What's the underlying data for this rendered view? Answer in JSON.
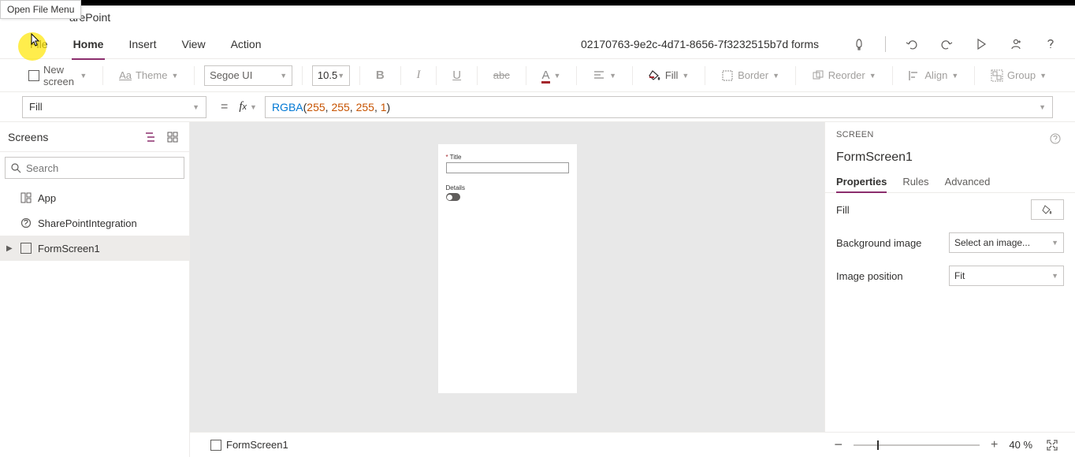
{
  "tooltip": "Open File Menu",
  "app_name": "arePoint",
  "tabs": {
    "file": "File",
    "home": "Home",
    "insert": "Insert",
    "view": "View",
    "action": "Action"
  },
  "doc_name": "02170763-9e2c-4d71-8656-7f3232515b7d forms",
  "toolbar": {
    "new_screen": "New screen",
    "theme": "Theme",
    "font": "Segoe UI",
    "font_size": "10.5",
    "fill": "Fill",
    "border": "Border",
    "reorder": "Reorder",
    "align": "Align",
    "group": "Group"
  },
  "formula": {
    "property": "Fill",
    "fn": "RGBA",
    "args": [
      "255",
      "255",
      "255",
      "1"
    ]
  },
  "screens": {
    "title": "Screens",
    "search_placeholder": "Search",
    "items": {
      "app": "App",
      "sp_integration": "SharePointIntegration",
      "form_screen": "FormScreen1"
    }
  },
  "preview": {
    "title": "Title",
    "details": "Details"
  },
  "props_panel": {
    "header_label": "SCREEN",
    "screen_name": "FormScreen1",
    "tabs": {
      "properties": "Properties",
      "rules": "Rules",
      "advanced": "Advanced"
    },
    "fill_label": "Fill",
    "bg_image_label": "Background image",
    "bg_image_value": "Select an image...",
    "img_pos_label": "Image position",
    "img_pos_value": "Fit"
  },
  "statusbar": {
    "screen": "FormScreen1",
    "zoom_pct": "40",
    "pct_symbol": "%"
  }
}
